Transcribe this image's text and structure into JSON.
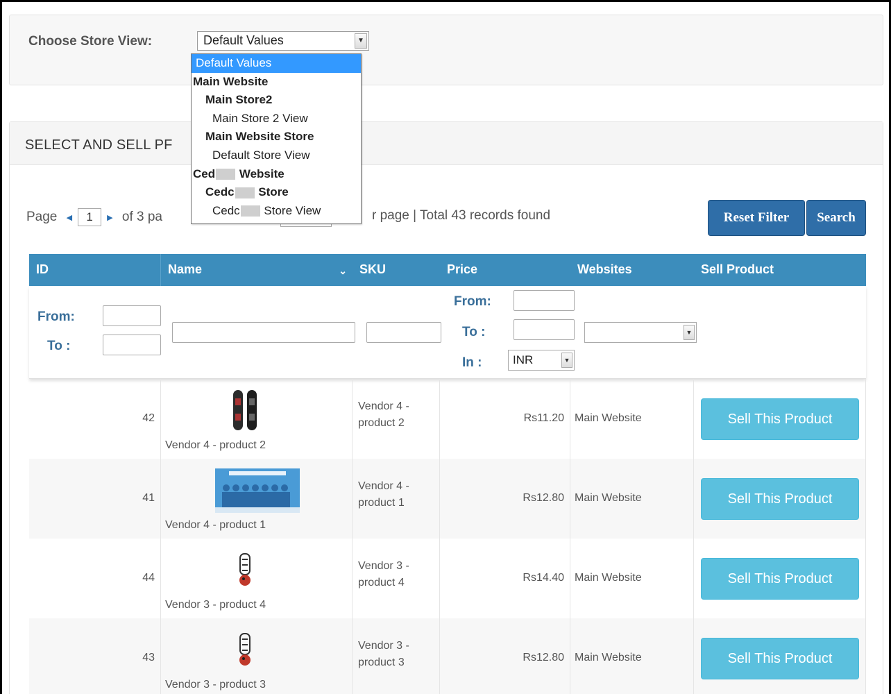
{
  "store_view": {
    "label": "Choose Store View:",
    "selected": "Default Values",
    "options": [
      {
        "label": "Default Values",
        "level": "sel"
      },
      {
        "label": "Main Website",
        "level": "l0"
      },
      {
        "label": "Main Store2",
        "level": "l1"
      },
      {
        "label": "Main Store 2 View",
        "level": "l2"
      },
      {
        "label": "Main Website Store",
        "level": "l1"
      },
      {
        "label": "Default Store View",
        "level": "l2"
      },
      {
        "label_pre": "Ced",
        "label_post": " Website",
        "level": "l0"
      },
      {
        "label_pre": "Cedc",
        "label_post": " Store",
        "level": "l1"
      },
      {
        "label_pre": "Cedc",
        "label_post": " Store View",
        "level": "l2"
      }
    ]
  },
  "panel": {
    "title": "SELECT AND SELL PF",
    "pager": {
      "prefix": "Page",
      "current": "1",
      "of_text": "of 3 pa",
      "tail_text": "r page | Total 43 records found"
    },
    "reset_label": "Reset Filter",
    "search_label": "Search"
  },
  "table": {
    "headers": {
      "id": "ID",
      "name": "Name",
      "sku": "SKU",
      "price": "Price",
      "websites": "Websites",
      "sell": "Sell Product"
    },
    "filters": {
      "from_label": "From:",
      "to_label": "To :",
      "in_label": "In :",
      "currency": "INR"
    },
    "rows": [
      {
        "id": "42",
        "name": "Vendor 4 - product 2",
        "sku_line1": "Vendor 4 -",
        "sku_line2": "product 2",
        "price": "Rs11.20",
        "website": "Main Website",
        "sell_label": "Sell This Product",
        "thumb": "snowboard-icon"
      },
      {
        "id": "41",
        "name": "Vendor 4 - product 1",
        "sku_line1": "Vendor 4 -",
        "sku_line2": "product 1",
        "price": "Rs12.80",
        "website": "Main Website",
        "sell_label": "Sell This Product",
        "thumb": "group-photo-icon"
      },
      {
        "id": "44",
        "name": "Vendor 3 - product 4",
        "sku_line1": "Vendor 3 -",
        "sku_line2": "product 4",
        "price": "Rs14.40",
        "website": "Main Website",
        "sell_label": "Sell This Product",
        "thumb": "skateboard-icon"
      },
      {
        "id": "43",
        "name": "Vendor 3 - product 3",
        "sku_line1": "Vendor 3 -",
        "sku_line2": "product 3",
        "price": "Rs12.80",
        "website": "Main Website",
        "sell_label": "Sell This Product",
        "thumb": "skateboard-icon"
      }
    ]
  }
}
